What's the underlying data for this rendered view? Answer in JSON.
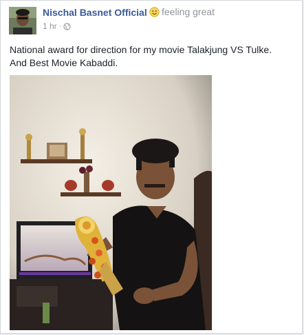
{
  "post": {
    "author": "Nischal Basnet Official",
    "feeling": "feeling great",
    "feeling_icon": "smiley-emoji-icon",
    "timestamp": "1 hr",
    "separator": "·",
    "privacy_icon": "globe-icon",
    "text_line1": "National award for direction for my movie Talakjung VS Tulke.",
    "text_line2": "And Best Movie Kabaddi.",
    "accent_color": "#3b5998"
  }
}
